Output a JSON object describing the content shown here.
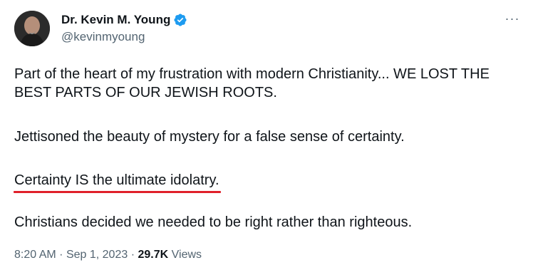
{
  "author": {
    "display_name": "Dr. Kevin M. Young",
    "handle": "@kevinmyoung",
    "verified": true,
    "verified_color": "#1d9bf0"
  },
  "menu": {
    "more_icon": "more-horizontal-icon",
    "more_label": "···"
  },
  "tweet": {
    "paragraphs": [
      "Part of the heart of my frustration with modern Christianity... WE LOST THE BEST PARTS OF OUR JEWISH ROOTS.",
      "Jettisoned the beauty of mystery for a false sense of certainty.",
      "Certainty IS the ultimate idolatry.",
      "Christians decided we needed to be right rather than righteous."
    ],
    "highlight_color": "#e0202a"
  },
  "meta": {
    "time": "8:20 AM",
    "date": "Sep 1, 2023",
    "separator": "·",
    "views_count": "29.7K",
    "views_label": "Views"
  }
}
